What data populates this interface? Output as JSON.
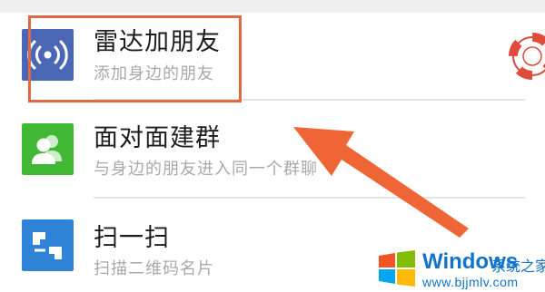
{
  "menu": {
    "items": [
      {
        "title": "雷达加朋友",
        "subtitle": "添加身边的朋友",
        "icon": "radar-signal-icon",
        "icon_color": "#4a67b6"
      },
      {
        "title": "面对面建群",
        "subtitle": "与身边的朋友进入同一个群聊",
        "icon": "face-to-face-group-icon",
        "icon_color": "#41b834"
      },
      {
        "title": "扫一扫",
        "subtitle": "扫描二维码名片",
        "icon": "scan-icon",
        "icon_color": "#2f83d7"
      }
    ]
  },
  "annotation": {
    "box_color": "#e06a44",
    "arrow_color": "#ef6536"
  },
  "watermark": {
    "brand": "Windows",
    "cn_text": "系统之家",
    "url": "www.bjjmlv.com",
    "color": "#1173c9"
  }
}
